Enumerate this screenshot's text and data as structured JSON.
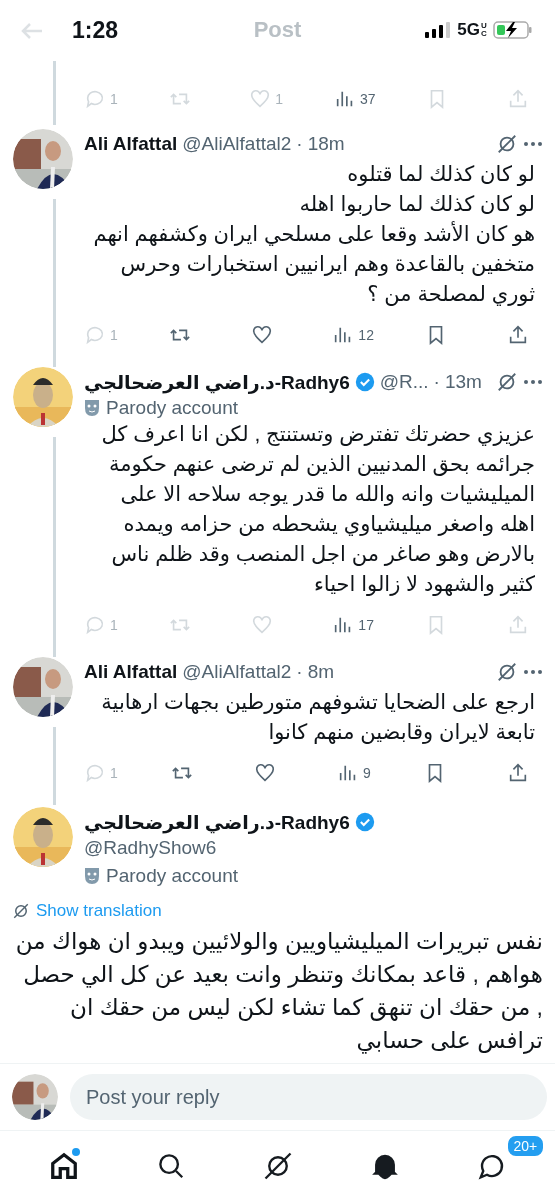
{
  "status_bar": {
    "time": "1:28",
    "network": "5G",
    "network_suffix": "UC",
    "charging": true
  },
  "header": {
    "title": "Post"
  },
  "previous_actions": {
    "reply": {
      "count": "1",
      "faded": true
    },
    "repost": {
      "faded": true
    },
    "like": {
      "count": "1",
      "faded": true
    },
    "views": {
      "count": "37",
      "faded": false
    },
    "bookmark": {
      "faded": true
    },
    "share": {
      "faded": true
    }
  },
  "replies": [
    {
      "name": "Ali Alfattal",
      "verified": false,
      "handle": "@AliAlfattal2",
      "separator": "·",
      "time": "18m",
      "body": "لو كان كذلك لما قتلوه\nلو كان كذلك لما حاربوا اهله\nهو كان الأشد وقعا على مسلحي ايران وكشفهم انهم متخفين بالقاعدة وهم ايرانيين استخبارات وحرس ثوري لمصلحة من ؟",
      "actions": {
        "reply": {
          "count": "1",
          "faded": true
        },
        "repost": {
          "faded": false
        },
        "like": {
          "faded": false
        },
        "views": {
          "count": "12",
          "faded": false
        },
        "bookmark": {
          "faded": false
        },
        "share": {
          "faded": false
        }
      }
    },
    {
      "name": "د.راضي العرضحالجي-Radhy6",
      "verified": true,
      "handle": "@R...",
      "separator": "·",
      "time": "13m",
      "parody": "Parody account",
      "body": "عزيزي حضرتك تفترض وتستنتج , لكن انا اعرف كل جرائمه بحق المدنيين الذين لم ترضى عنهم حكومة الميليشيات وانه والله ما قدر يوجه سلاحه الا على اهله واصغر ميليشياوي يشحطه من حزامه ويمده بالارض وهو صاغر من اجل المنصب وقد ظلم ناس كثير والشهود لا زالوا احياء",
      "actions": {
        "reply": {
          "count": "1",
          "faded": true
        },
        "repost": {
          "faded": true
        },
        "like": {
          "faded": true
        },
        "views": {
          "count": "17",
          "faded": false
        },
        "bookmark": {
          "faded": true
        },
        "share": {
          "faded": true
        }
      }
    },
    {
      "name": "Ali Alfattal",
      "verified": false,
      "handle": "@AliAlfattal2",
      "separator": "·",
      "time": "8m",
      "body": "ارجع على الضحايا تشوفهم متورطين بجهات ارهابية تابعة لايران وقابضين منهم كانوا",
      "actions": {
        "reply": {
          "count": "1",
          "faded": true
        },
        "repost": {
          "faded": false
        },
        "like": {
          "faded": false
        },
        "views": {
          "count": "9",
          "faded": false
        },
        "bookmark": {
          "faded": false
        },
        "share": {
          "faded": false
        }
      }
    }
  ],
  "main_post": {
    "name": "د.راضي العرضحالجي-Radhy6",
    "verified": true,
    "handle": "@RadhyShow6",
    "parody": "Parody account",
    "translate_link": "Show translation",
    "body": "نفس تبريرات الميليشياويين والولائيين ويبدو ان هواك من هواهم , قاعد بمكانك وتنظر وانت بعيد عن كل الي حصل , من حقك ان تنهق كما تشاء لكن ليس من حقك ان ترافس على حسابي"
  },
  "reply_bar": {
    "placeholder": "Post your reply"
  },
  "bottom_nav": [
    {
      "kind": "home",
      "selected": true,
      "dot": true
    },
    {
      "kind": "search",
      "selected": false
    },
    {
      "kind": "grok",
      "selected": false
    },
    {
      "kind": "notifications",
      "selected": false
    },
    {
      "kind": "messages",
      "selected": false,
      "badge": "20+"
    }
  ]
}
